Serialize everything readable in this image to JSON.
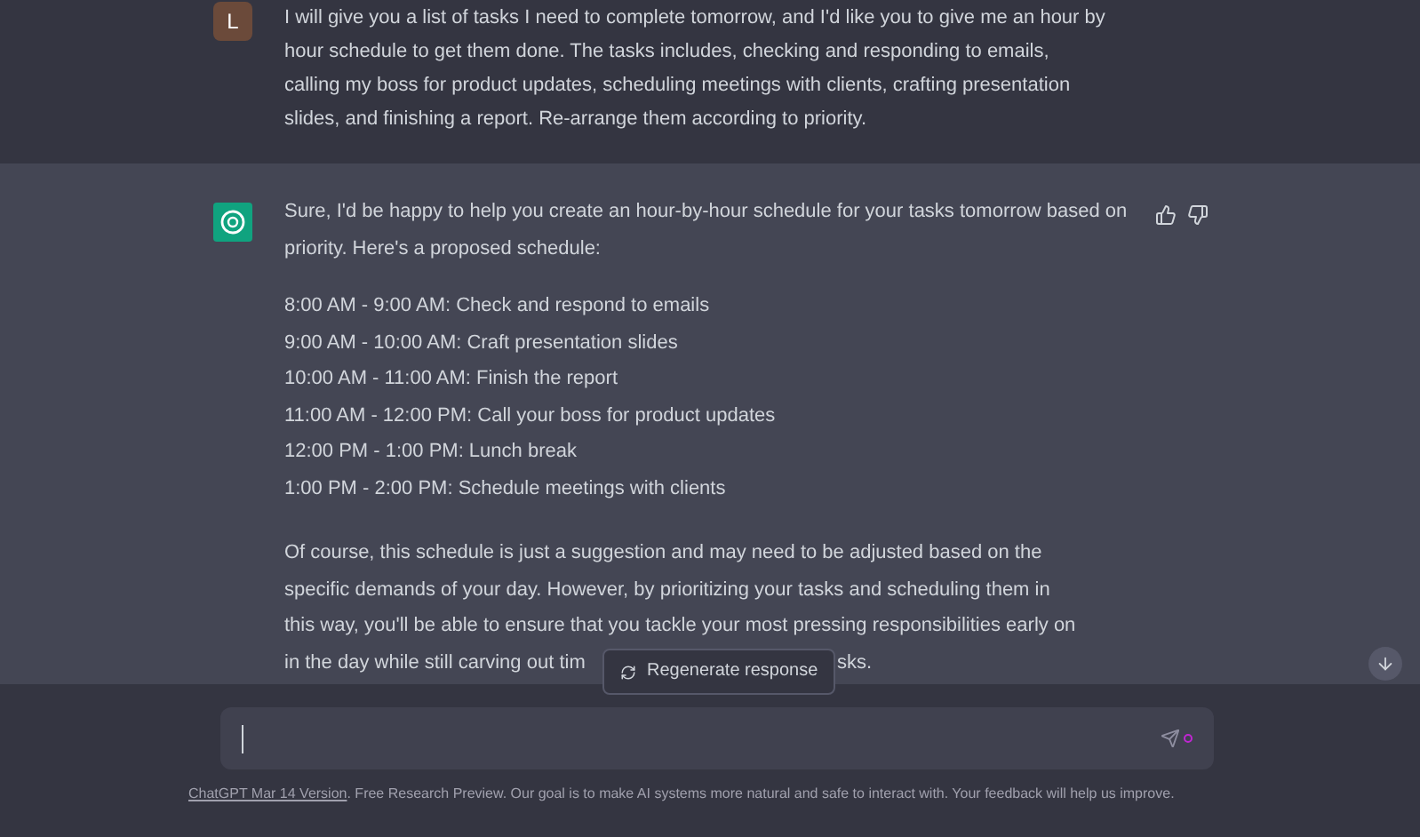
{
  "user_message": {
    "avatar": "L",
    "text": "I will give you a list of tasks I need to complete tomorrow, and I'd like you to give me an hour by hour schedule to get them done. The tasks includes, checking and responding to emails, calling my boss for product updates, scheduling meetings with clients, crafting presentation slides, and finishing a report. Re-arrange them according to priority."
  },
  "assistant_message": {
    "intro": "Sure, I'd be happy to help you create an hour-by-hour schedule for your tasks tomorrow based on priority. Here's a proposed schedule:",
    "schedule": [
      "8:00 AM - 9:00 AM: Check and respond to emails",
      "9:00 AM - 10:00 AM: Craft presentation slides",
      "10:00 AM - 11:00 AM: Finish the report",
      "11:00 AM - 12:00 PM: Call your boss for product updates",
      "12:00 PM - 1:00 PM: Lunch break",
      "1:00 PM - 2:00 PM: Schedule meetings with clients"
    ],
    "closing": "Of course, this schedule is just a suggestion and may need to be adjusted based on the specific demands of your day. However, by prioritizing your tasks and scheduling them in this way, you'll be able to ensure that you tackle your most pressing responsibilities early on",
    "closing_line_4": "in the day while still carving out tim",
    "closing_tail": "sks."
  },
  "regenerate_button": "Regenerate response",
  "footer": {
    "link": "ChatGPT Mar 14 Version",
    "text": ". Free Research Preview. Our goal is to make AI systems more natural and safe to interact with. Your feedback will help us improve."
  }
}
